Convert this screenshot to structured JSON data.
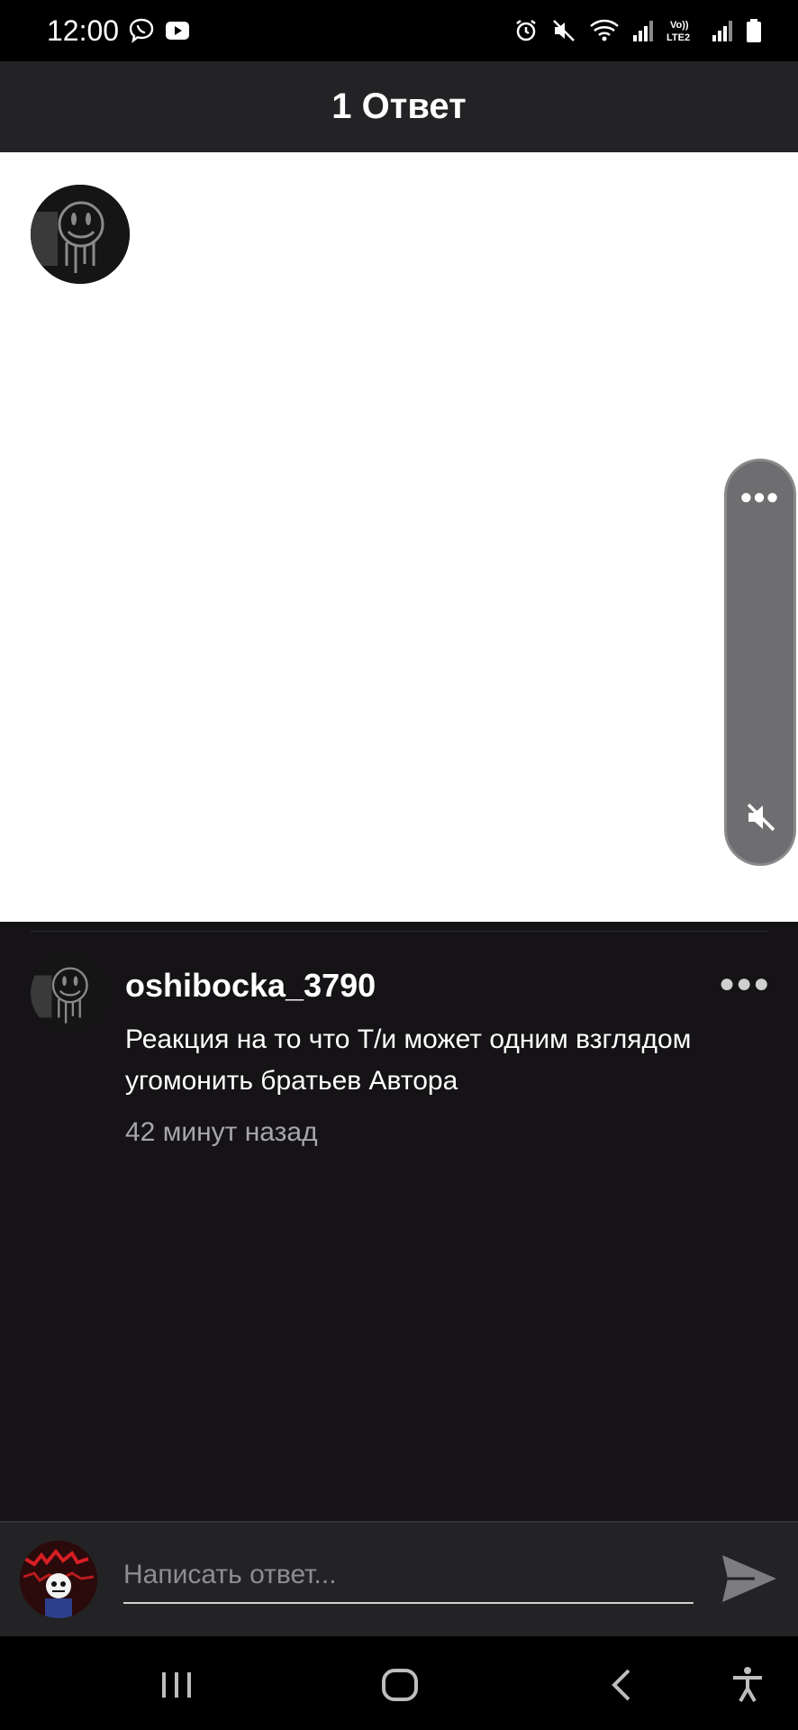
{
  "status_bar": {
    "time": "12:00",
    "left_icons": [
      "viber-icon",
      "youtube-icon"
    ],
    "right_icons": [
      "alarm-icon",
      "mute-icon",
      "wifi-icon",
      "signal-icon",
      "volte-lte2-icon",
      "signal-icon",
      "battery-icon"
    ],
    "network_label": "Vo)) LTE2"
  },
  "header": {
    "title": "1 Ответ"
  },
  "video": {
    "controls": [
      "more-icon",
      "mute-icon"
    ]
  },
  "comment": {
    "author": "oshibocka_3790",
    "text": "Реакция на то что Т/и может одним взглядом угомонить братьев Автора",
    "time": "42 минут назад"
  },
  "reply": {
    "placeholder": "Написать ответ..."
  },
  "nav_bar": {
    "buttons": [
      "recents-icon",
      "home-icon",
      "back-icon",
      "accessibility-icon"
    ]
  },
  "colors": {
    "background": "#151316",
    "header": "#232224",
    "status_bar": "#000000",
    "video_bg": "#ffffff",
    "muted_text": "#a7a6aa"
  }
}
